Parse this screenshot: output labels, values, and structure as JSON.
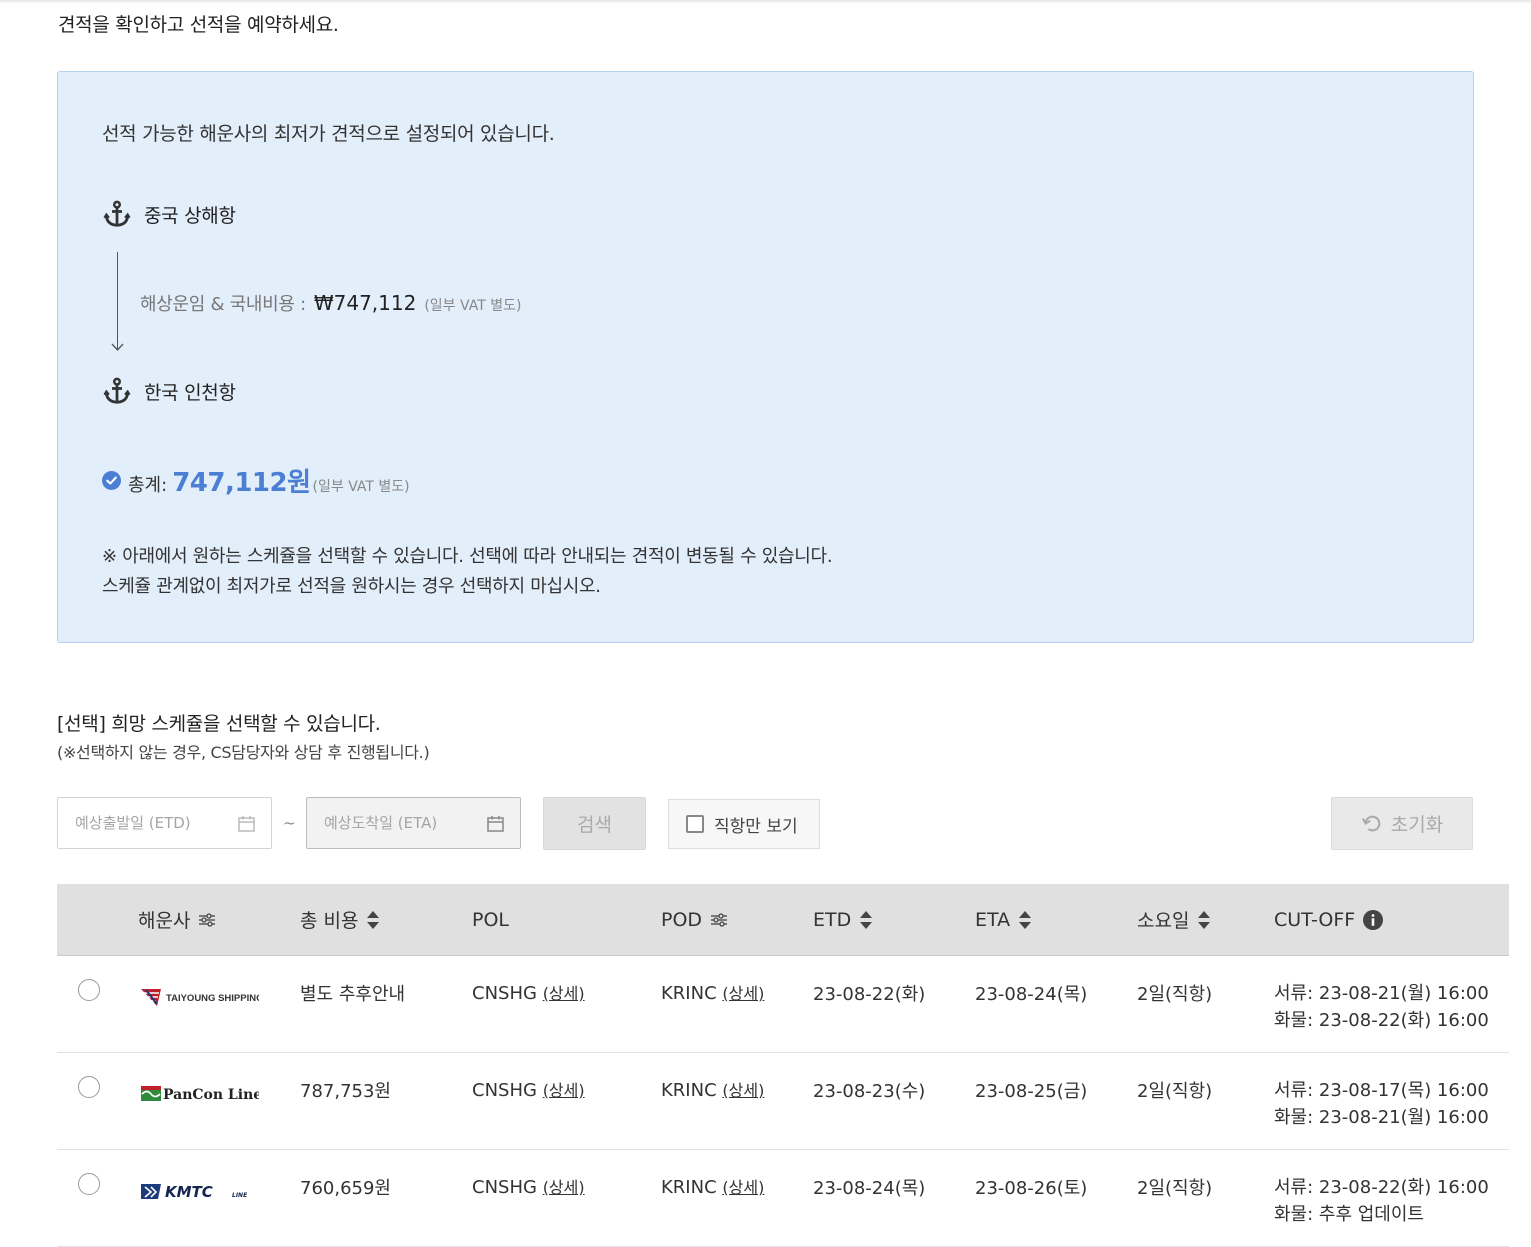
{
  "page": {
    "title": "견적을 확인하고 선적을 예약하세요."
  },
  "quote": {
    "intro": "선적 가능한 해운사의 최저가 견적으로 설정되어 있습니다.",
    "origin_port": "중국 상해항",
    "destination_port": "한국 인천항",
    "freight_label": "해상운임 & 국내비용 :",
    "freight_value": "₩747,112",
    "freight_note": "(일부 VAT 별도)",
    "total_label": "총계:",
    "total_value": "747,112원",
    "total_note": "(일부 VAT 별도)",
    "notice_line1": "※ 아래에서 원하는 스케쥴을 선택할 수 있습니다. 선택에 따라 안내되는 견적이 변동될 수 있습니다.",
    "notice_line2": "스케쥴 관계없이 최저가로 선적을 원하시는 경우 선택하지 마십시오.",
    "colors": {
      "box_bg": "#e3eefb",
      "box_border": "#b7d2ef",
      "accent": "#4a7fd4"
    }
  },
  "schedule": {
    "title": "[선택] 희망 스케쥴을 선택할 수 있습니다.",
    "subtitle": "(※선택하지 않는 경우, CS담당자와 상담 후 진행됩니다.)"
  },
  "filters": {
    "etd_placeholder": "예상출발일 (ETD)",
    "eta_placeholder": "예상도착일 (ETA)",
    "range_separator": "~",
    "search_label": "검색",
    "direct_only_label": "직항만 보기",
    "direct_only_checked": false,
    "reset_label": "초기화"
  },
  "table": {
    "columns": {
      "carrier": "해운사",
      "cost": "총 비용",
      "pol": "POL",
      "pod": "POD",
      "etd": "ETD",
      "eta": "ETA",
      "duration": "소요일",
      "cutoff": "CUT-OFF"
    },
    "detail_link": "(상세)",
    "rows": [
      {
        "carrier_logo": "TAIYOUNG SHIPPING",
        "cost": "별도 추후안내",
        "pol": "CNSHG",
        "pod": "KRINC",
        "etd": "23-08-22(화)",
        "eta": "23-08-24(목)",
        "duration": "2일(직항)",
        "cutoff_doc": "서류: 23-08-21(월) 16:00",
        "cutoff_cargo": "화물: 23-08-22(화) 16:00"
      },
      {
        "carrier_logo": "PanCon Line",
        "cost": "787,753원",
        "pol": "CNSHG",
        "pod": "KRINC",
        "etd": "23-08-23(수)",
        "eta": "23-08-25(금)",
        "duration": "2일(직항)",
        "cutoff_doc": "서류: 23-08-17(목) 16:00",
        "cutoff_cargo": "화물: 23-08-21(월) 16:00"
      },
      {
        "carrier_logo": "KMTC",
        "carrier_logo_sub": "LINE",
        "cost": "760,659원",
        "pol": "CNSHG",
        "pod": "KRINC",
        "etd": "23-08-24(목)",
        "eta": "23-08-26(토)",
        "duration": "2일(직항)",
        "cutoff_doc": "서류: 23-08-22(화) 16:00",
        "cutoff_cargo": "화물: 추후 업데이트"
      }
    ]
  },
  "icons": {
    "port": "anchor-icon",
    "total": "check-circle-icon",
    "date": "calendar-icon",
    "reset": "undo-icon",
    "filter": "sliders-icon",
    "sort": "sort-icon",
    "info": "info-icon"
  }
}
